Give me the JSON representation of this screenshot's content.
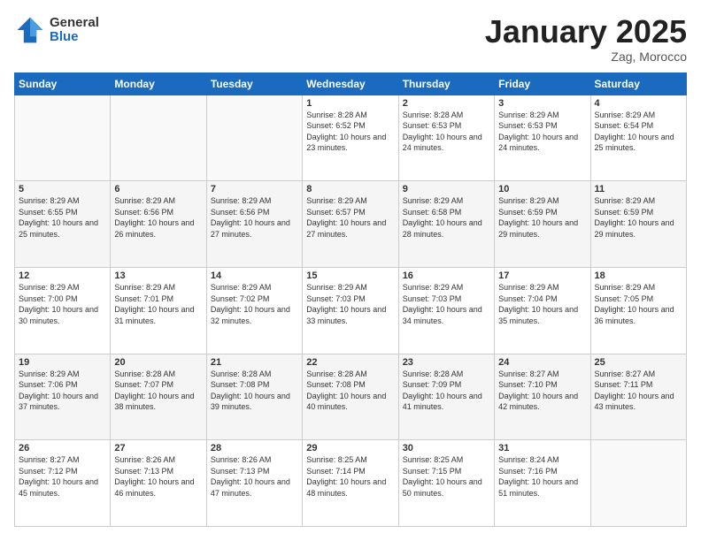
{
  "header": {
    "logo_general": "General",
    "logo_blue": "Blue",
    "month_title": "January 2025",
    "location": "Zag, Morocco"
  },
  "weekdays": [
    "Sunday",
    "Monday",
    "Tuesday",
    "Wednesday",
    "Thursday",
    "Friday",
    "Saturday"
  ],
  "weeks": [
    [
      {
        "day": "",
        "sunrise": "",
        "sunset": "",
        "daylight": ""
      },
      {
        "day": "",
        "sunrise": "",
        "sunset": "",
        "daylight": ""
      },
      {
        "day": "",
        "sunrise": "",
        "sunset": "",
        "daylight": ""
      },
      {
        "day": "1",
        "sunrise": "Sunrise: 8:28 AM",
        "sunset": "Sunset: 6:52 PM",
        "daylight": "Daylight: 10 hours and 23 minutes."
      },
      {
        "day": "2",
        "sunrise": "Sunrise: 8:28 AM",
        "sunset": "Sunset: 6:53 PM",
        "daylight": "Daylight: 10 hours and 24 minutes."
      },
      {
        "day": "3",
        "sunrise": "Sunrise: 8:29 AM",
        "sunset": "Sunset: 6:53 PM",
        "daylight": "Daylight: 10 hours and 24 minutes."
      },
      {
        "day": "4",
        "sunrise": "Sunrise: 8:29 AM",
        "sunset": "Sunset: 6:54 PM",
        "daylight": "Daylight: 10 hours and 25 minutes."
      }
    ],
    [
      {
        "day": "5",
        "sunrise": "Sunrise: 8:29 AM",
        "sunset": "Sunset: 6:55 PM",
        "daylight": "Daylight: 10 hours and 25 minutes."
      },
      {
        "day": "6",
        "sunrise": "Sunrise: 8:29 AM",
        "sunset": "Sunset: 6:56 PM",
        "daylight": "Daylight: 10 hours and 26 minutes."
      },
      {
        "day": "7",
        "sunrise": "Sunrise: 8:29 AM",
        "sunset": "Sunset: 6:56 PM",
        "daylight": "Daylight: 10 hours and 27 minutes."
      },
      {
        "day": "8",
        "sunrise": "Sunrise: 8:29 AM",
        "sunset": "Sunset: 6:57 PM",
        "daylight": "Daylight: 10 hours and 27 minutes."
      },
      {
        "day": "9",
        "sunrise": "Sunrise: 8:29 AM",
        "sunset": "Sunset: 6:58 PM",
        "daylight": "Daylight: 10 hours and 28 minutes."
      },
      {
        "day": "10",
        "sunrise": "Sunrise: 8:29 AM",
        "sunset": "Sunset: 6:59 PM",
        "daylight": "Daylight: 10 hours and 29 minutes."
      },
      {
        "day": "11",
        "sunrise": "Sunrise: 8:29 AM",
        "sunset": "Sunset: 6:59 PM",
        "daylight": "Daylight: 10 hours and 29 minutes."
      }
    ],
    [
      {
        "day": "12",
        "sunrise": "Sunrise: 8:29 AM",
        "sunset": "Sunset: 7:00 PM",
        "daylight": "Daylight: 10 hours and 30 minutes."
      },
      {
        "day": "13",
        "sunrise": "Sunrise: 8:29 AM",
        "sunset": "Sunset: 7:01 PM",
        "daylight": "Daylight: 10 hours and 31 minutes."
      },
      {
        "day": "14",
        "sunrise": "Sunrise: 8:29 AM",
        "sunset": "Sunset: 7:02 PM",
        "daylight": "Daylight: 10 hours and 32 minutes."
      },
      {
        "day": "15",
        "sunrise": "Sunrise: 8:29 AM",
        "sunset": "Sunset: 7:03 PM",
        "daylight": "Daylight: 10 hours and 33 minutes."
      },
      {
        "day": "16",
        "sunrise": "Sunrise: 8:29 AM",
        "sunset": "Sunset: 7:03 PM",
        "daylight": "Daylight: 10 hours and 34 minutes."
      },
      {
        "day": "17",
        "sunrise": "Sunrise: 8:29 AM",
        "sunset": "Sunset: 7:04 PM",
        "daylight": "Daylight: 10 hours and 35 minutes."
      },
      {
        "day": "18",
        "sunrise": "Sunrise: 8:29 AM",
        "sunset": "Sunset: 7:05 PM",
        "daylight": "Daylight: 10 hours and 36 minutes."
      }
    ],
    [
      {
        "day": "19",
        "sunrise": "Sunrise: 8:29 AM",
        "sunset": "Sunset: 7:06 PM",
        "daylight": "Daylight: 10 hours and 37 minutes."
      },
      {
        "day": "20",
        "sunrise": "Sunrise: 8:28 AM",
        "sunset": "Sunset: 7:07 PM",
        "daylight": "Daylight: 10 hours and 38 minutes."
      },
      {
        "day": "21",
        "sunrise": "Sunrise: 8:28 AM",
        "sunset": "Sunset: 7:08 PM",
        "daylight": "Daylight: 10 hours and 39 minutes."
      },
      {
        "day": "22",
        "sunrise": "Sunrise: 8:28 AM",
        "sunset": "Sunset: 7:08 PM",
        "daylight": "Daylight: 10 hours and 40 minutes."
      },
      {
        "day": "23",
        "sunrise": "Sunrise: 8:28 AM",
        "sunset": "Sunset: 7:09 PM",
        "daylight": "Daylight: 10 hours and 41 minutes."
      },
      {
        "day": "24",
        "sunrise": "Sunrise: 8:27 AM",
        "sunset": "Sunset: 7:10 PM",
        "daylight": "Daylight: 10 hours and 42 minutes."
      },
      {
        "day": "25",
        "sunrise": "Sunrise: 8:27 AM",
        "sunset": "Sunset: 7:11 PM",
        "daylight": "Daylight: 10 hours and 43 minutes."
      }
    ],
    [
      {
        "day": "26",
        "sunrise": "Sunrise: 8:27 AM",
        "sunset": "Sunset: 7:12 PM",
        "daylight": "Daylight: 10 hours and 45 minutes."
      },
      {
        "day": "27",
        "sunrise": "Sunrise: 8:26 AM",
        "sunset": "Sunset: 7:13 PM",
        "daylight": "Daylight: 10 hours and 46 minutes."
      },
      {
        "day": "28",
        "sunrise": "Sunrise: 8:26 AM",
        "sunset": "Sunset: 7:13 PM",
        "daylight": "Daylight: 10 hours and 47 minutes."
      },
      {
        "day": "29",
        "sunrise": "Sunrise: 8:25 AM",
        "sunset": "Sunset: 7:14 PM",
        "daylight": "Daylight: 10 hours and 48 minutes."
      },
      {
        "day": "30",
        "sunrise": "Sunrise: 8:25 AM",
        "sunset": "Sunset: 7:15 PM",
        "daylight": "Daylight: 10 hours and 50 minutes."
      },
      {
        "day": "31",
        "sunrise": "Sunrise: 8:24 AM",
        "sunset": "Sunset: 7:16 PM",
        "daylight": "Daylight: 10 hours and 51 minutes."
      },
      {
        "day": "",
        "sunrise": "",
        "sunset": "",
        "daylight": ""
      }
    ]
  ]
}
